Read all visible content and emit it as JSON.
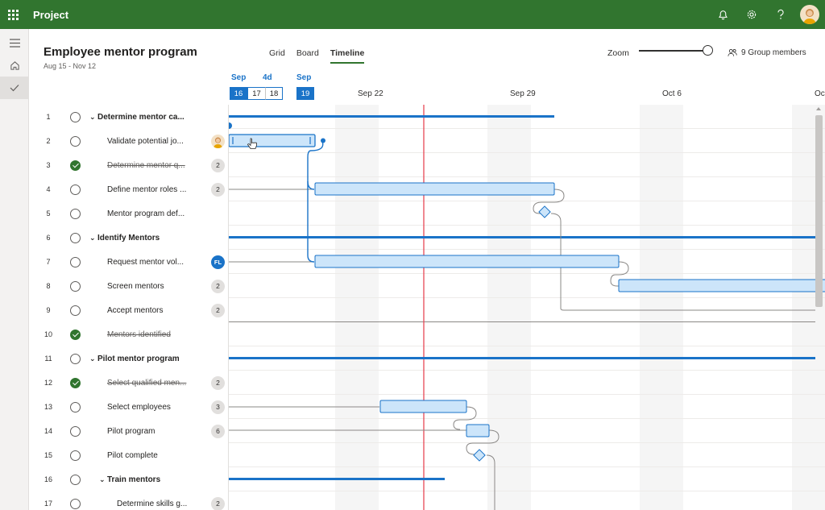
{
  "app": {
    "name": "Project"
  },
  "topbar_icons": [
    "waffle-icon",
    "bell-icon",
    "gear-icon",
    "help-icon",
    "avatar"
  ],
  "plan": {
    "title": "Employee mentor program",
    "dates": "Aug 15 - Nov 12"
  },
  "views": [
    {
      "label": "Grid",
      "active": false
    },
    {
      "label": "Board",
      "active": false
    },
    {
      "label": "Timeline",
      "active": true
    }
  ],
  "zoom": {
    "label": "Zoom",
    "level": 1.0
  },
  "members": {
    "label": "9 Group members"
  },
  "timeline_header": {
    "months": [
      "Sep",
      "4d",
      "Sep"
    ],
    "days": [
      {
        "label": "16",
        "selected": true
      },
      {
        "label": "17",
        "selected": false
      },
      {
        "label": "18",
        "selected": false
      },
      {
        "label": "19",
        "selected": true
      }
    ],
    "weeks": [
      "Sep 22",
      "Sep 29",
      "Oct 6",
      "Oc"
    ]
  },
  "tasks": [
    {
      "num": "1",
      "name": "Determine mentor ca...",
      "summary": true,
      "level": 0,
      "done": false,
      "badge": ""
    },
    {
      "num": "2",
      "name": "Validate potential jo...",
      "summary": false,
      "level": 1,
      "done": false,
      "badge": "photo"
    },
    {
      "num": "3",
      "name": "Determine mentor q...",
      "summary": false,
      "level": 1,
      "done": true,
      "badge": "2"
    },
    {
      "num": "4",
      "name": "Define mentor roles ...",
      "summary": false,
      "level": 1,
      "done": false,
      "badge": "2"
    },
    {
      "num": "5",
      "name": "Mentor program def...",
      "summary": false,
      "level": 1,
      "done": false,
      "badge": ""
    },
    {
      "num": "6",
      "name": "Identify Mentors",
      "summary": true,
      "level": 0,
      "done": false,
      "badge": ""
    },
    {
      "num": "7",
      "name": "Request mentor vol...",
      "summary": false,
      "level": 1,
      "done": false,
      "badge": "FL"
    },
    {
      "num": "8",
      "name": "Screen mentors",
      "summary": false,
      "level": 1,
      "done": false,
      "badge": "2"
    },
    {
      "num": "9",
      "name": "Accept mentors",
      "summary": false,
      "level": 1,
      "done": false,
      "badge": "2"
    },
    {
      "num": "10",
      "name": "Mentors identified",
      "summary": false,
      "level": 1,
      "done": true,
      "badge": ""
    },
    {
      "num": "11",
      "name": "Pilot mentor program",
      "summary": true,
      "level": 0,
      "done": false,
      "badge": ""
    },
    {
      "num": "12",
      "name": "Select qualified men...",
      "summary": false,
      "level": 1,
      "done": true,
      "badge": "2"
    },
    {
      "num": "13",
      "name": "Select employees",
      "summary": false,
      "level": 1,
      "done": false,
      "badge": "3"
    },
    {
      "num": "14",
      "name": "Pilot program",
      "summary": false,
      "level": 1,
      "done": false,
      "badge": "6"
    },
    {
      "num": "15",
      "name": "Pilot complete",
      "summary": false,
      "level": 1,
      "done": false,
      "badge": ""
    },
    {
      "num": "16",
      "name": "Train mentors",
      "summary": true,
      "level": 1,
      "done": false,
      "badge": ""
    },
    {
      "num": "17",
      "name": "Determine skills g...",
      "summary": false,
      "level": 2,
      "done": false,
      "badge": "2"
    }
  ],
  "colors": {
    "brand": "#31752f",
    "bar_fill": "#cce5fa",
    "bar_border": "#1a73c8",
    "today_line": "#e74856"
  }
}
